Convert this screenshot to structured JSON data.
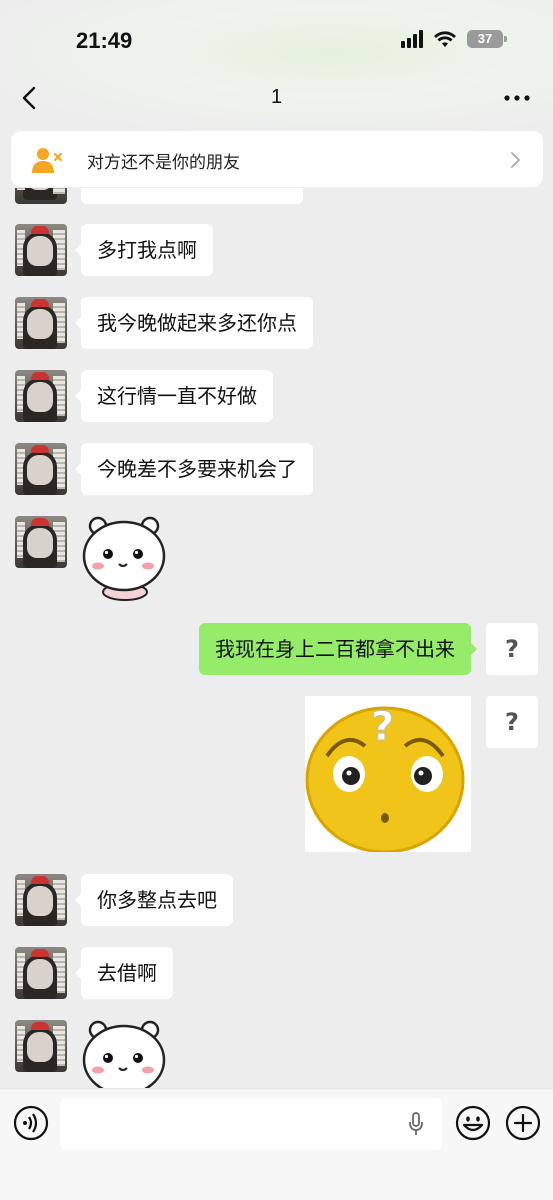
{
  "status_bar": {
    "time": "21:49",
    "battery": "37"
  },
  "nav": {
    "title": "1",
    "back_icon": "chevron-left-icon",
    "more_icon": "more-dots-icon"
  },
  "notice": {
    "text": "对方还不是你的朋友",
    "icon": "add-friend-icon",
    "accent_color": "#f5a623"
  },
  "messages": [
    {
      "side": "left",
      "type": "text",
      "text": "多打我点啊"
    },
    {
      "side": "left",
      "type": "text",
      "text": "我今晚做起来多还你点"
    },
    {
      "side": "left",
      "type": "text",
      "text": "这行情一直不好做"
    },
    {
      "side": "left",
      "type": "text",
      "text": "今晚差不多要来机会了"
    },
    {
      "side": "left",
      "type": "sticker",
      "sticker": "white-bear-sticker"
    },
    {
      "side": "right",
      "type": "text",
      "text": "我现在身上二百都拿不出来",
      "marker": "?"
    },
    {
      "side": "right",
      "type": "sticker",
      "sticker": "confused-face-sticker",
      "marker": "?"
    },
    {
      "side": "left",
      "type": "text",
      "text": "你多整点去吧"
    },
    {
      "side": "left",
      "type": "text",
      "text": "去借啊"
    },
    {
      "side": "left",
      "type": "sticker",
      "sticker": "white-bear-sticker"
    }
  ],
  "colors": {
    "sent_bubble": "#95ec69",
    "received_bubble": "#ffffff",
    "background": "#ededed"
  },
  "input_bar": {
    "voice_icon": "voice-icon",
    "mic_icon": "microphone-icon",
    "emoji_icon": "emoji-icon",
    "plus_icon": "plus-circle-icon"
  }
}
